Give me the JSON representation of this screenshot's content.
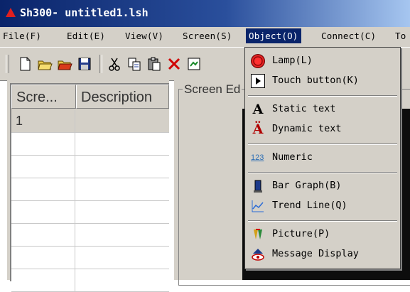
{
  "title_bar": {
    "title": "Sh300- untitled1.lsh",
    "icon": "app-triangle-icon"
  },
  "menubar": {
    "items": [
      {
        "label": "File(F)"
      },
      {
        "label": "Edit(E)"
      },
      {
        "label": "View(V)"
      },
      {
        "label": "Screen(S)"
      },
      {
        "label": "Object(O)",
        "active": true
      },
      {
        "label": "Connect(C)"
      },
      {
        "label": "To"
      }
    ]
  },
  "toolbar": {
    "icons": [
      "new-file-icon",
      "open-folder-icon",
      "open-red-folder-icon",
      "save-icon",
      "cut-icon",
      "copy-icon",
      "paste-icon",
      "delete-icon",
      "screen-icon"
    ]
  },
  "grid": {
    "columns": [
      "Scre...",
      "Description"
    ],
    "rows": [
      {
        "screen": "1",
        "description": ""
      },
      {
        "screen": "",
        "description": ""
      },
      {
        "screen": "",
        "description": ""
      },
      {
        "screen": "",
        "description": ""
      },
      {
        "screen": "",
        "description": ""
      },
      {
        "screen": "",
        "description": ""
      },
      {
        "screen": "",
        "description": ""
      },
      {
        "screen": "",
        "description": ""
      }
    ]
  },
  "editor": {
    "group_label": "Screen Ed"
  },
  "object_menu": {
    "items": [
      {
        "label": "Lamp(L)",
        "icon": "lamp-icon"
      },
      {
        "label": "Touch button(K)",
        "icon": "touch-button-icon"
      },
      {
        "label": "Static  text",
        "icon": "static-text-icon",
        "glyph": "A"
      },
      {
        "label": "Dynamic text",
        "icon": "dynamic-text-icon",
        "glyph": "Ä"
      },
      {
        "label": "Numeric",
        "icon": "numeric-icon",
        "glyph": "123"
      },
      {
        "label": "Bar Graph(B)",
        "icon": "bar-graph-icon"
      },
      {
        "label": "Trend Line(Q)",
        "icon": "trend-line-icon"
      },
      {
        "label": "Picture(P)",
        "icon": "picture-icon"
      },
      {
        "label": "Message Display",
        "icon": "message-display-icon"
      }
    ]
  }
}
